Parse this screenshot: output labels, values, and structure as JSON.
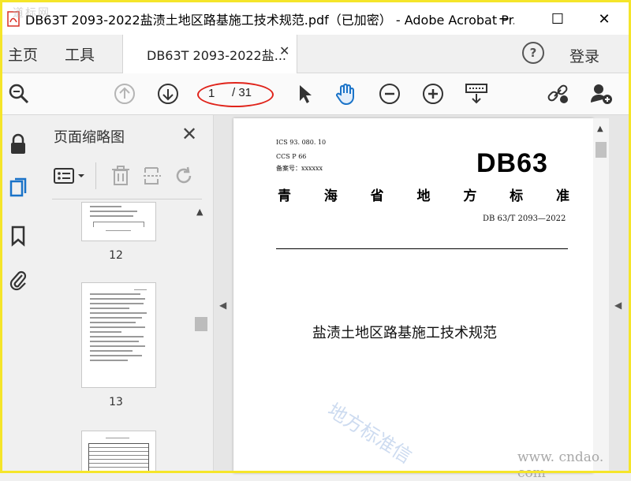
{
  "window": {
    "title": "DB63T 2093-2022盐渍土地区路基施工技术规范.pdf（已加密） - Adobe Acrobat Pr...",
    "minimize": "─",
    "maximize": "☐",
    "close": "✕",
    "corner_watermark": "道标网"
  },
  "menubar": {
    "home": "主页",
    "tools": "工具",
    "doc_tab": "DB63T 2093-2022盐...",
    "tab_close": "✕",
    "help": "?",
    "login": "登录"
  },
  "toolbar": {
    "page_current": "1",
    "page_total": "/ 31"
  },
  "panel": {
    "title": "页面缩略图",
    "close": "✕",
    "thumbnails": [
      {
        "number": "12"
      },
      {
        "number": "13"
      }
    ]
  },
  "document": {
    "ics": "ICS 93. 080. 10",
    "ccs": "CCS  P  66",
    "record": "备案号：xxxxxx",
    "db_code": "DB63",
    "province_chars": [
      "青",
      "海",
      "省",
      "地",
      "方",
      "标",
      "准"
    ],
    "std_code": "DB 63/T  2093—2022",
    "title": "盐渍土地区路基施工技术规范",
    "watermark": "地方标准信",
    "site_watermark": "www. cndao. com"
  },
  "colors": {
    "accent": "#1a73c8",
    "highlight_ellipse": "#e0241b",
    "frame": "#f5e52a"
  }
}
